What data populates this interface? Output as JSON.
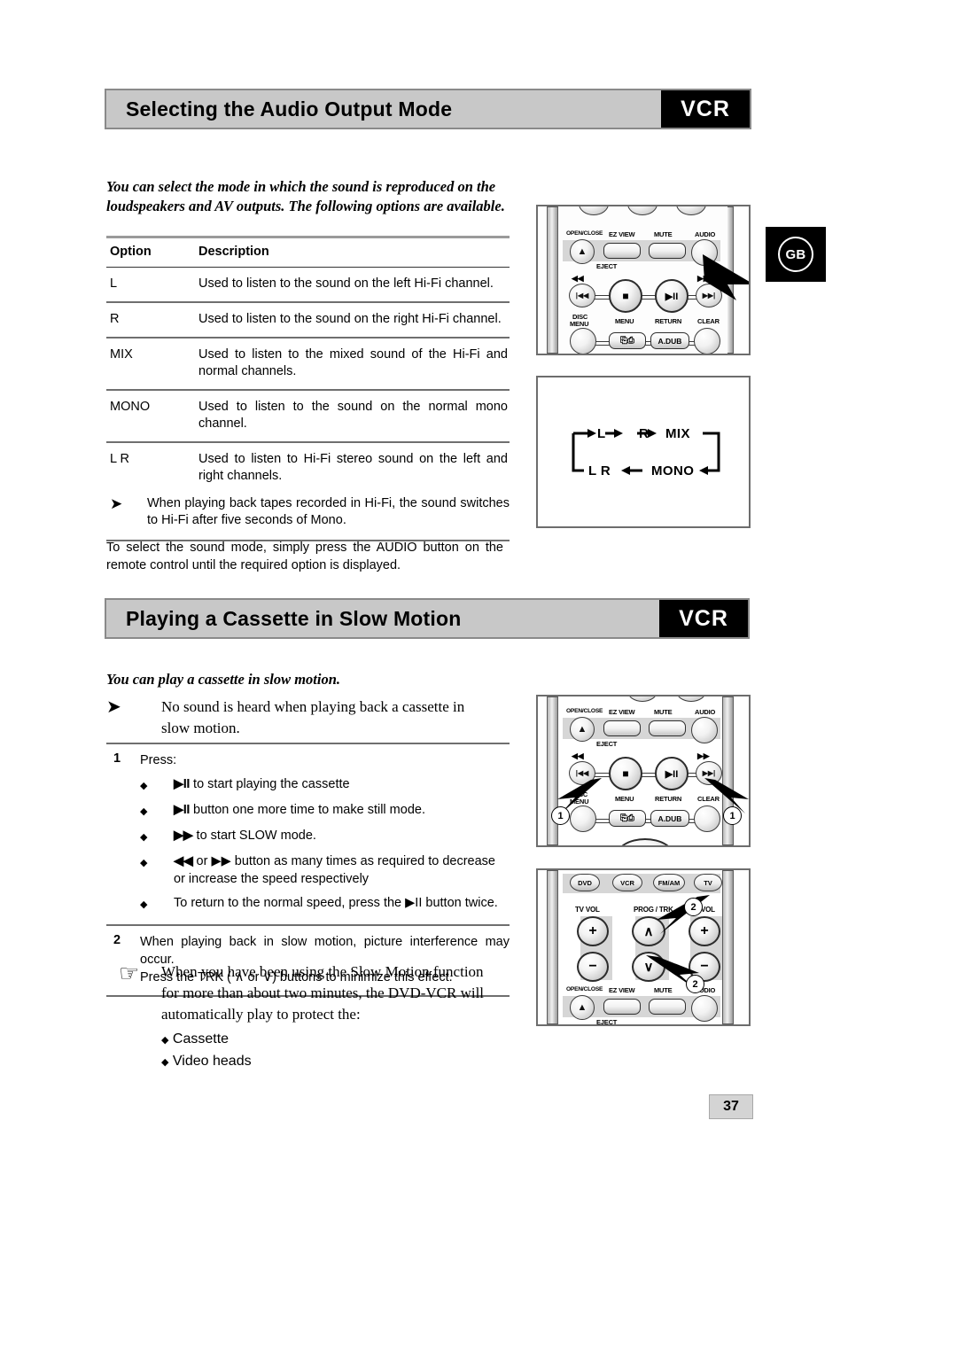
{
  "page": {
    "number": "37",
    "locale_badge": "GB"
  },
  "section1": {
    "title": "Selecting the Audio Output Mode",
    "tag": "VCR",
    "intro": "You can select the mode in which the sound is reproduced on the loudspeakers and AV outputs. The following options are available.",
    "table": {
      "headers": [
        "Option",
        "Description"
      ],
      "rows": [
        {
          "option": "L",
          "description": "Used to listen to the sound on the left Hi-Fi channel."
        },
        {
          "option": "R",
          "description": "Used to listen to the sound on the right Hi-Fi channel."
        },
        {
          "option": "MIX",
          "description": "Used to listen to the mixed sound of the Hi-Fi and normal channels."
        },
        {
          "option": "MONO",
          "description": "Used to listen to the sound on the normal mono channel."
        },
        {
          "option": "L R",
          "description": "Used to listen to Hi-Fi stereo sound on the left and right channels."
        }
      ],
      "subnote": "When playing back tapes recorded in Hi-Fi, the sound switches to Hi-Fi after five seconds of Mono."
    },
    "closing": "To select the sound mode, simply press the AUDIO button on the remote control until the required option is displayed."
  },
  "cycle_diagram": {
    "nodes": [
      "L",
      "R",
      "MIX",
      "MONO",
      "L R"
    ]
  },
  "section2": {
    "title": "Playing a Cassette in Slow Motion",
    "tag": "VCR",
    "intro": "You can play a cassette in slow motion.",
    "note": "No sound is heard when playing back a cassette in slow motion.",
    "steps": [
      {
        "number": "1",
        "text": "Press:",
        "bullets": [
          {
            "prefix": "▶II",
            "text": "to start playing the cassette"
          },
          {
            "prefix": "▶II",
            "text": "button one more time to make still mode."
          },
          {
            "prefix": "▶▶",
            "text": "to start SLOW mode."
          },
          {
            "prefix": "◀◀",
            "text": "or ▶▶ button as many times as required to decrease or increase the speed respectively"
          },
          {
            "prefix": "",
            "text": "To return to the normal speed, press the ▶II button twice."
          }
        ]
      },
      {
        "number": "2",
        "text": "When playing back in slow motion, picture interference may occur.",
        "text2": "Press the TRK ( ∧ or ∨) buttons to minimize this effect."
      }
    ],
    "closing_note": {
      "text": "When you have been using the Slow Motion function for more than about two minutes, the DVD-VCR will automatically play to protect the:",
      "items": [
        "Cassette",
        "Video heads"
      ]
    }
  },
  "remote_top": {
    "labels": {
      "open_close": "OPEN/CLOSE",
      "ez_view": "EZ VIEW",
      "mute": "MUTE",
      "audio": "AUDIO",
      "eject": "EJECT",
      "rew": "◀◀",
      "ff": "▶▶",
      "disc_menu_1": "DISC",
      "disc_menu_2": "MENU",
      "menu": "MENU",
      "return": "RETURN",
      "clear": "CLEAR",
      "adub": "A.DUB",
      "skip_back": "|◀◀",
      "skip_fwd": "▶▶|",
      "stop": "■",
      "play_pause": "▶II"
    }
  },
  "remote_mid": {
    "callouts": [
      "1",
      "1"
    ]
  },
  "remote_bottom": {
    "labels": {
      "dvd": "DVD",
      "vcr": "VCR",
      "fm_am": "FM/AM",
      "tv": "TV",
      "tv_vol": "TV VOL",
      "prog_trk": "PROG / TRK",
      "vol": "VOL",
      "plus": "+",
      "minus": "−",
      "up": "∧",
      "down": "∨",
      "open_close": "OPEN/CLOSE",
      "ez_view": "EZ VIEW",
      "mute": "MUTE",
      "audio": "AUDIO",
      "eject": "EJECT"
    },
    "callouts": [
      "2",
      "2"
    ]
  }
}
